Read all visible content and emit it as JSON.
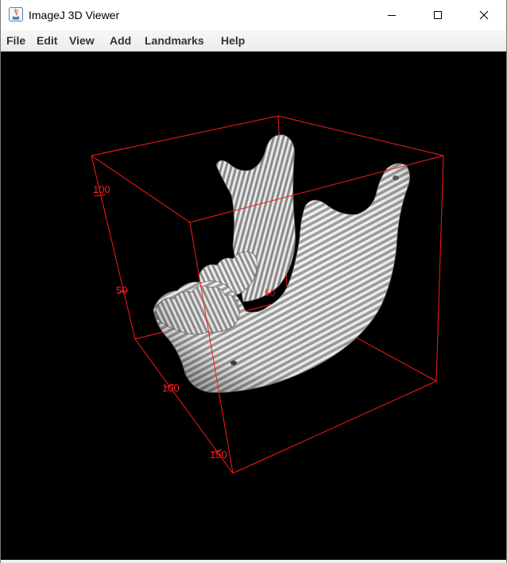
{
  "window": {
    "title": "ImageJ 3D Viewer",
    "controls": {
      "minimize": "minimize-icon",
      "maximize": "maximize-icon",
      "close": "close-icon"
    }
  },
  "menubar": {
    "items": [
      "File",
      "Edit",
      "View",
      "Add",
      "Landmarks",
      "Help"
    ]
  },
  "viewer": {
    "background_color": "#000000",
    "bounding_box_color": "#ff1a1a",
    "object": "mandible-3d-surface",
    "axis_labels": {
      "vertical_upper": "100",
      "vertical_lower": "50",
      "depth_near": "100",
      "depth_far": "150",
      "hidden_mid": "50"
    }
  }
}
